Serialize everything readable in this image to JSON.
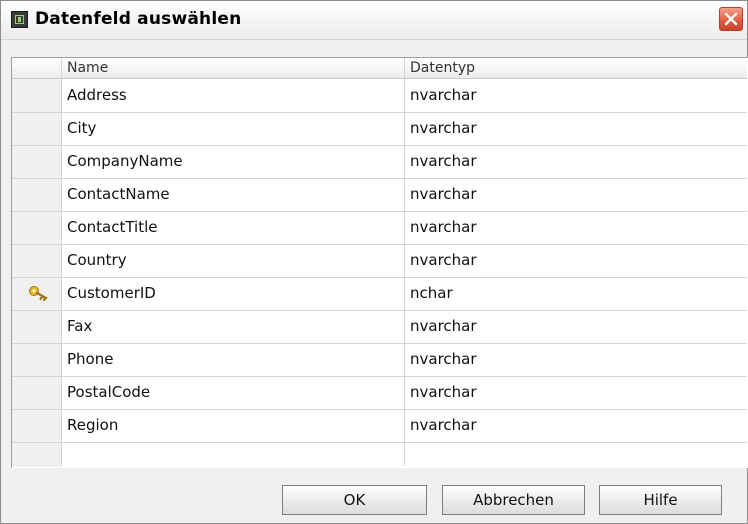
{
  "window": {
    "title": "Datenfeld auswählen"
  },
  "table": {
    "columns": [
      "Name",
      "Datentyp"
    ],
    "rows": [
      {
        "name": "Address",
        "type": "nvarchar",
        "key": false
      },
      {
        "name": "City",
        "type": "nvarchar",
        "key": false
      },
      {
        "name": "CompanyName",
        "type": "nvarchar",
        "key": false
      },
      {
        "name": "ContactName",
        "type": "nvarchar",
        "key": false
      },
      {
        "name": "ContactTitle",
        "type": "nvarchar",
        "key": false
      },
      {
        "name": "Country",
        "type": "nvarchar",
        "key": false
      },
      {
        "name": "CustomerID",
        "type": "nchar",
        "key": true
      },
      {
        "name": "Fax",
        "type": "nvarchar",
        "key": false
      },
      {
        "name": "Phone",
        "type": "nvarchar",
        "key": false
      },
      {
        "name": "PostalCode",
        "type": "nvarchar",
        "key": false
      },
      {
        "name": "Region",
        "type": "nvarchar",
        "key": false
      }
    ]
  },
  "buttons": {
    "ok": "OK",
    "cancel": "Abbrechen",
    "help": "Hilfe"
  },
  "icons": {
    "window": "app-icon",
    "close": "close-icon",
    "key": "key-icon"
  },
  "colors": {
    "close_button": "#e05a3c",
    "key_icon": "#e8b82a"
  }
}
